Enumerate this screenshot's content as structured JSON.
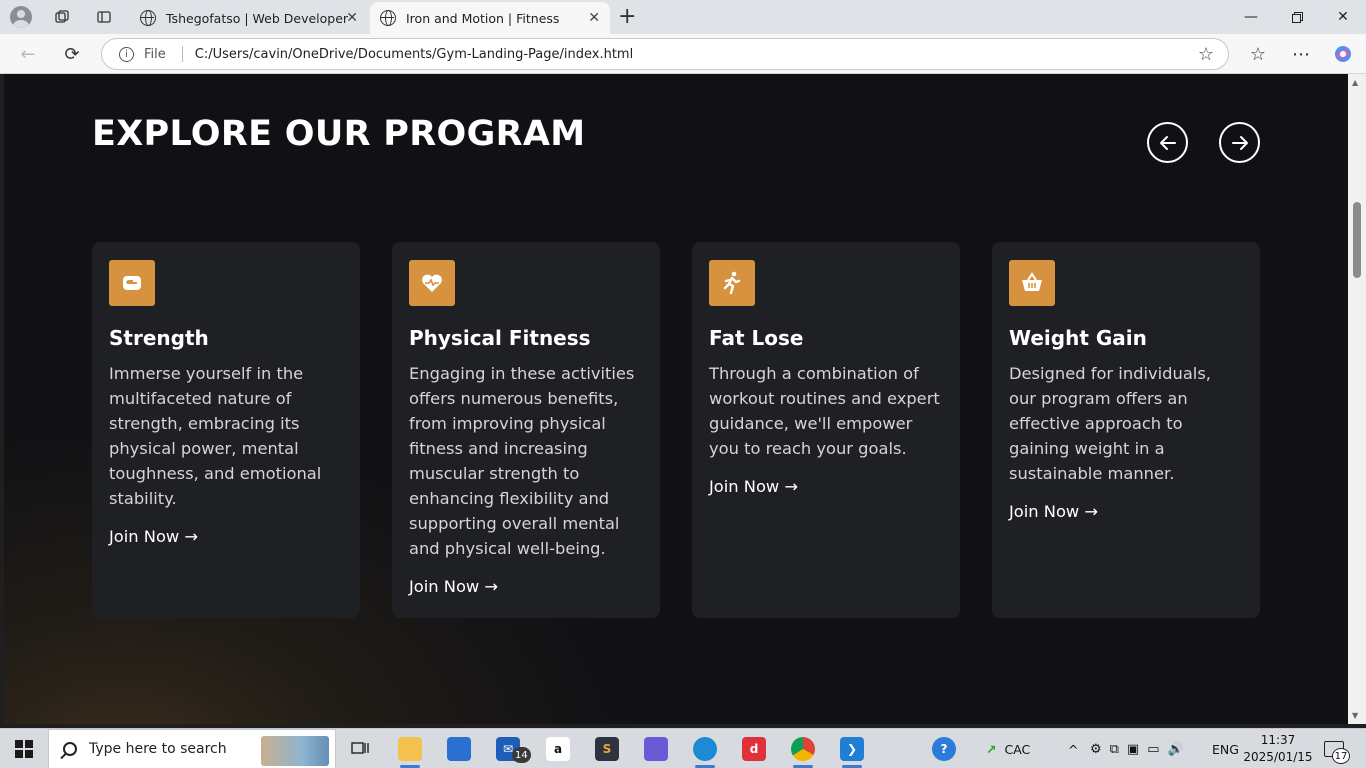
{
  "browser": {
    "tabs": [
      {
        "title": "Tshegofatso | Web Developer",
        "active": false
      },
      {
        "title": "Iron and Motion | Fitness",
        "active": true
      }
    ],
    "address": {
      "security_label": "File",
      "url": "C:/Users/cavin/OneDrive/Documents/Gym-Landing-Page/index.html"
    }
  },
  "page": {
    "heading": "EXPLORE OUR PROGRAM",
    "cards": [
      {
        "icon": "dumbbell-icon",
        "title": "Strength",
        "text": "Immerse yourself in the multifaceted nature of strength, embracing its physical power, mental toughness, and emotional stability.",
        "cta": "Join Now →"
      },
      {
        "icon": "heart-pulse-icon",
        "title": "Physical Fitness",
        "text": "Engaging in these activities offers numerous benefits, from improving physical fitness and increasing muscular strength to enhancing flexibility and supporting overall mental and physical well-being.",
        "cta": "Join Now →"
      },
      {
        "icon": "running-icon",
        "title": "Fat Lose",
        "text": "Through a combination of workout routines and expert guidance, we'll empower you to reach your goals.",
        "cta": "Join Now →"
      },
      {
        "icon": "basket-icon",
        "title": "Weight Gain",
        "text": "Designed for individuals, our program offers an effective approach to gaining weight in a sustainable manner.",
        "cta": "Join Now →"
      }
    ],
    "accent_color": "#d6923f",
    "card_bg": "#1f2023"
  },
  "taskbar": {
    "search_placeholder": "Type here to search",
    "mail_badge": "14",
    "weather": "CAC",
    "language": "ENG",
    "time": "11:37",
    "date": "2025/01/15",
    "notification_count": "17"
  }
}
